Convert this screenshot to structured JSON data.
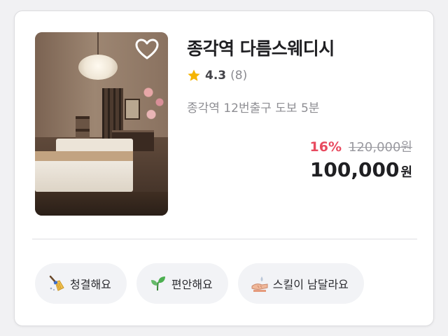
{
  "shop": {
    "name": "종각역 다름스웨디시",
    "rating": "4.3",
    "review_count": "(8)",
    "location": "종각역 12번출구 도보 5분",
    "discount": "16%",
    "original_price": "120,000원",
    "price": "100,000",
    "currency": "원",
    "favorite": false
  },
  "tags": [
    {
      "label": "청결해요",
      "icon": "broom-icon"
    },
    {
      "label": "편안해요",
      "icon": "leaf-icon"
    },
    {
      "label": "스킬이 남달라요",
      "icon": "massage-hands-icon"
    }
  ],
  "colors": {
    "discount": "#e84a5f",
    "star": "#f5b400",
    "tag_background": "#f2f3f6"
  }
}
